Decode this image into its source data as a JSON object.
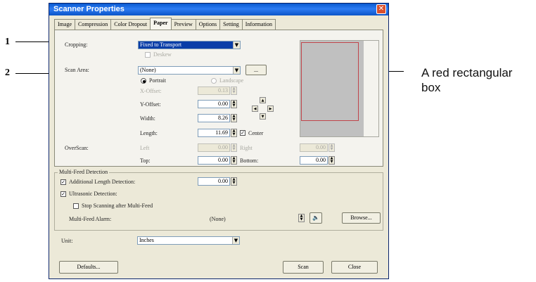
{
  "window": {
    "title": "Scanner Properties",
    "close_glyph": "✕"
  },
  "tabs": [
    "Image",
    "Compression",
    "Color Dropout",
    "Paper",
    "Preview",
    "Options",
    "Setting",
    "Information"
  ],
  "active_tab": "Paper",
  "paper": {
    "cropping_label": "Cropping:",
    "cropping_value": "Fixed to Transport",
    "deskew_label": "Deskew",
    "scan_area_label": "Scan Area:",
    "scan_area_value": "(None)",
    "scan_area_button": "...",
    "portrait_label": "Portrait",
    "landscape_label": "Landscape",
    "x_offset_label": "X-Offset:",
    "x_offset_value": "0.13",
    "y_offset_label": "Y-Offset:",
    "y_offset_value": "0.00",
    "width_label": "Width:",
    "width_value": "8.26",
    "length_label": "Length:",
    "length_value": "11.69",
    "center_label": "Center",
    "overscan_label": "OverScan:",
    "left_label": "Left",
    "left_value": "0.00",
    "right_label": "Right",
    "right_value": "0.00",
    "top_label": "Top:",
    "top_value": "0.00",
    "bottom_label": "Bottom:",
    "bottom_value": "0.00"
  },
  "multifeed": {
    "group_label": "Multi-Feed Detection",
    "additional_length_label": "Additional Length Detection:",
    "additional_length_value": "0.00",
    "ultrasonic_label": "Ultrasonic Detection:",
    "stop_label": "Stop Scanning after Multi-Feed",
    "alarm_label": "Multi-Feed Alarm:",
    "alarm_value": "(None)",
    "browse_label": "Browse..."
  },
  "unit": {
    "label": "Unit:",
    "value": "Inches"
  },
  "footer": {
    "defaults_label": "Defaults...",
    "scan_label": "Scan",
    "close_label": "Close"
  },
  "annotations": {
    "num1": "1",
    "num2": "2",
    "red_box_text": "A red rectangular box"
  },
  "colors": {
    "title_bar": "#0a5ad0",
    "red_box": "#c0444a",
    "selection": "#0a3ea8"
  },
  "icons": {
    "speaker": "speaker-icon",
    "close": "close-icon",
    "dropdown": "chevron-down-icon"
  }
}
